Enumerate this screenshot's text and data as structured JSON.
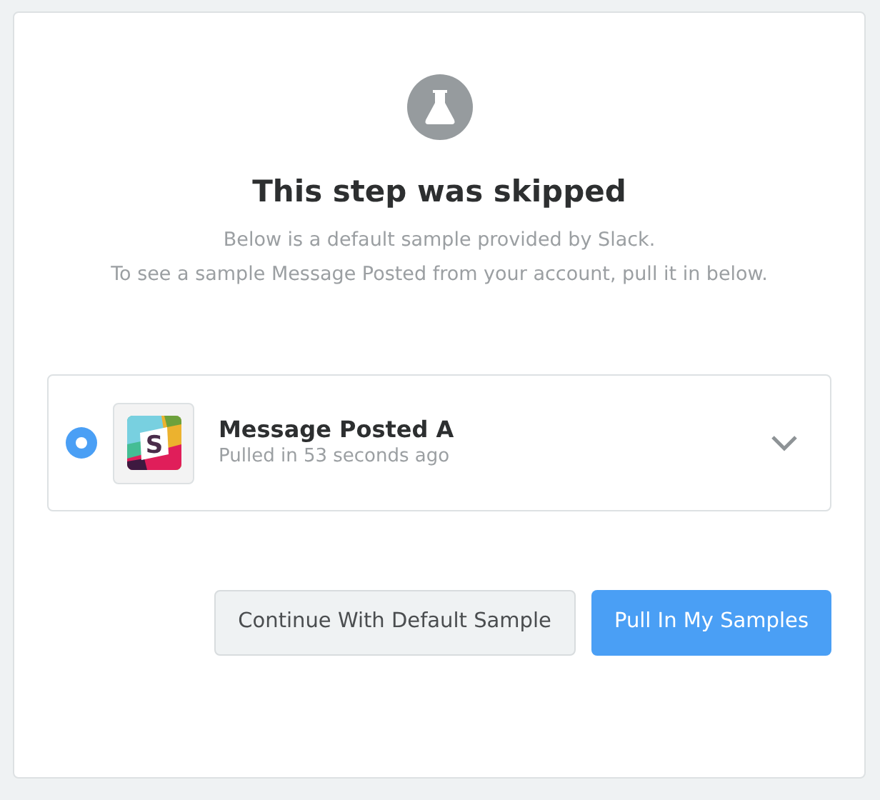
{
  "heading": "This step was skipped",
  "description": [
    "Below is a default sample provided by Slack.",
    "To see a sample Message Posted from your account, pull it in below."
  ],
  "samples": [
    {
      "logo_letter": "S",
      "title": "Message Posted A",
      "subtitle": "Pulled in 53 seconds ago",
      "selected": true
    }
  ],
  "buttons": [
    {
      "label": "Continue With Default Sample",
      "kind": "secondary"
    },
    {
      "label": "Pull In My Samples",
      "kind": "primary"
    }
  ]
}
